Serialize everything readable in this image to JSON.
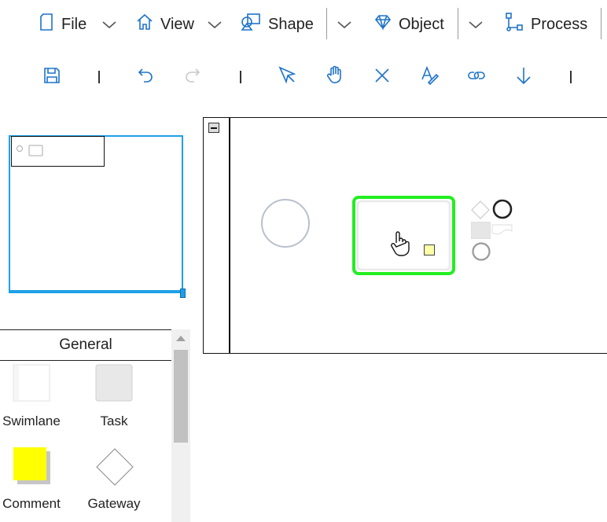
{
  "menubar": {
    "file_label": "File",
    "view_label": "View",
    "shape_label": "Shape",
    "object_label": "Object",
    "process_label": "Process"
  },
  "toolbar": {
    "icons": [
      "save-icon",
      "undo-icon",
      "redo-icon",
      "select-pointer-icon",
      "pan-hand-icon",
      "delete-icon",
      "text-style-icon",
      "link-icon",
      "arrow-down-icon"
    ],
    "redo_enabled": false
  },
  "palette": {
    "group_title": "General",
    "items": [
      {
        "label": "Swimlane",
        "icon": "swimlane-icon"
      },
      {
        "label": "Task",
        "icon": "task-icon"
      },
      {
        "label": "Comment",
        "icon": "comment-icon",
        "color": "#ffff00"
      },
      {
        "label": "Gateway",
        "icon": "gateway-icon"
      }
    ]
  },
  "canvas": {
    "selection_color": "#22ee22",
    "comment_marker_color": "#ffffa8",
    "accent": "#1e73c9",
    "overview_border": "#1ea0e8"
  }
}
